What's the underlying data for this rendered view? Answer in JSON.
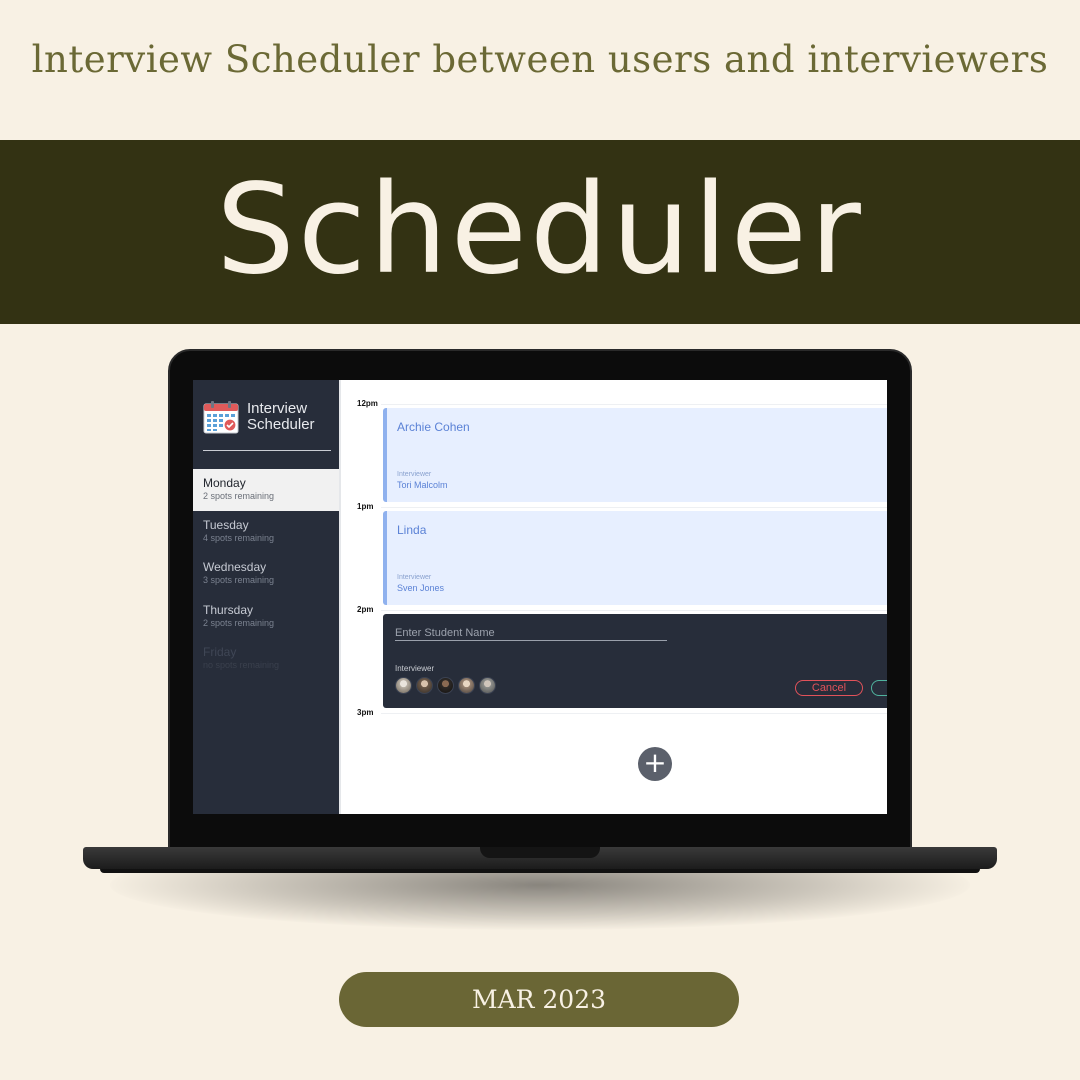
{
  "header": {
    "subtitle": "lnterview Scheduler between users and interviewers",
    "title": "Scheduler"
  },
  "app": {
    "brand_line1": "Interview",
    "brand_line2": "Scheduler",
    "days": [
      {
        "name": "Monday",
        "spots": "2 spots remaining",
        "state": "selected"
      },
      {
        "name": "Tuesday",
        "spots": "4 spots remaining",
        "state": "default"
      },
      {
        "name": "Wednesday",
        "spots": "3 spots remaining",
        "state": "default"
      },
      {
        "name": "Thursday",
        "spots": "2 spots remaining",
        "state": "default"
      },
      {
        "name": "Friday",
        "spots": "no spots remaining",
        "state": "full"
      }
    ],
    "hours": [
      "12pm",
      "1pm",
      "2pm",
      "3pm"
    ],
    "appointments": [
      {
        "student": "Archie Cohen",
        "interviewer_label": "Interviewer",
        "interviewer": "Tori Malcolm"
      },
      {
        "student": "Linda",
        "interviewer_label": "Interviewer",
        "interviewer": "Sven Jones"
      }
    ],
    "form": {
      "placeholder": "Enter Student Name",
      "interviewer_label": "Interviewer",
      "cancel_label": "Cancel",
      "avatar_count": 5
    },
    "add_icon": "+"
  },
  "footer": {
    "date": "MAR 2023"
  },
  "colors": {
    "background": "#f8f1e4",
    "banner": "#333213",
    "accent_olive": "#6a6635",
    "sidebar": "#272d3a",
    "appointment_bg": "#e7efff",
    "appointment_text": "#5b82d6",
    "cancel": "#e1525a",
    "save": "#4fb39e"
  }
}
